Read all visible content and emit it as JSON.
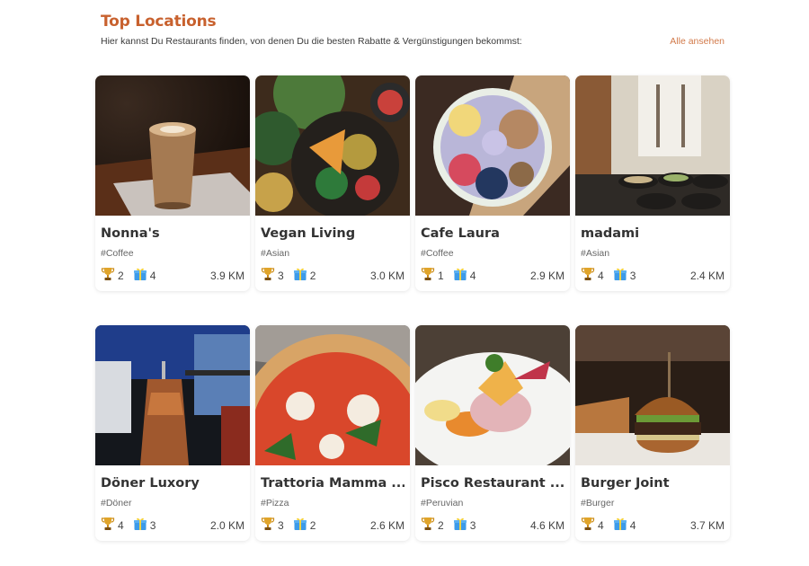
{
  "header": {
    "title": "Top Locations",
    "subtitle": "Hier kannst Du Restaurants finden, von denen Du die besten Rabatte & Vergünstigungen bekommst:",
    "see_all": "Alle ansehen"
  },
  "colors": {
    "accent": "#c8612e",
    "link": "#d27a4a"
  },
  "restaurants": [
    {
      "name": "Nonna's",
      "tag": "#Coffee",
      "trophies": "2",
      "gifts": "4",
      "distance": "3.9 KM",
      "image": "latte-coffee"
    },
    {
      "name": "Vegan Living",
      "tag": "#Asian",
      "trophies": "3",
      "gifts": "2",
      "distance": "3.0 KM",
      "image": "vegan-bowl"
    },
    {
      "name": "Cafe Laura",
      "tag": "#Coffee",
      "trophies": "1",
      "gifts": "4",
      "distance": "2.9 KM",
      "image": "acai-bowl"
    },
    {
      "name": "madami",
      "tag": "#Asian",
      "trophies": "4",
      "gifts": "3",
      "distance": "2.4 KM",
      "image": "restaurant-interior"
    },
    {
      "name": "Döner Luxory",
      "tag": "#Döner",
      "trophies": "4",
      "gifts": "3",
      "distance": "2.0 KM",
      "image": "doner-spit"
    },
    {
      "name": "Trattoria Mamma ...",
      "tag": "#Pizza",
      "trophies": "3",
      "gifts": "2",
      "distance": "2.6 KM",
      "image": "margherita-pizza"
    },
    {
      "name": "Pisco Restaurant ...",
      "tag": "#Peruvian",
      "trophies": "2",
      "gifts": "3",
      "distance": "4.6 KM",
      "image": "ceviche-plate"
    },
    {
      "name": "Burger Joint",
      "tag": "#Burger",
      "trophies": "4",
      "gifts": "4",
      "distance": "3.7 KM",
      "image": "burger"
    }
  ]
}
